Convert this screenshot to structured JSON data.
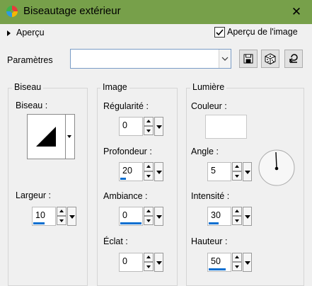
{
  "window": {
    "title": "Biseautage extérieur",
    "close_glyph": "✕"
  },
  "preview": {
    "toggle_label": "Aperçu",
    "checkbox_label": "Aperçu de l'image",
    "checked": true
  },
  "params": {
    "label": "Paramètres",
    "value": ""
  },
  "toolbar": {
    "save_icon": "save-icon",
    "random_icon": "dice-icon",
    "reset_icon": "reset-icon"
  },
  "biseau": {
    "group_title": "Biseau",
    "bevel_label": "Biseau :",
    "width_label": "Largeur :",
    "width_value": "10"
  },
  "image": {
    "group_title": "Image",
    "smoothness_label": "Régularité :",
    "smoothness_value": "0",
    "depth_label": "Profondeur :",
    "depth_value": "20",
    "ambience_label": "Ambiance :",
    "ambience_value": "0",
    "shininess_label": "Éclat :",
    "shininess_value": "0"
  },
  "light": {
    "group_title": "Lumière",
    "color_label": "Couleur :",
    "color_value": "#ffffff",
    "angle_label": "Angle :",
    "angle_value": "5",
    "intensity_label": "Intensité :",
    "intensity_value": "30",
    "elevation_label": "Hauteur :",
    "elevation_value": "50"
  },
  "colors": {
    "titlebar": "#77a04a",
    "accent": "#0a6fd0",
    "panel": "#f0f0f0"
  }
}
